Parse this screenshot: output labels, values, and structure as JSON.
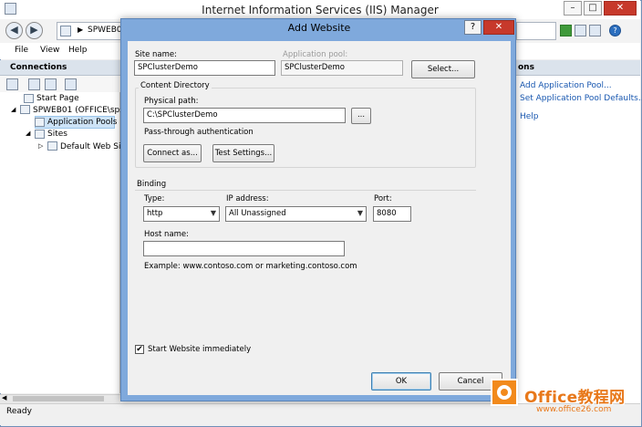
{
  "main_window": {
    "title": "Internet Information Services (IIS) Manager",
    "address": "SPWEB01",
    "menu": [
      "File",
      "View",
      "Help"
    ],
    "connections_title": "Connections",
    "tree": [
      {
        "label": "Start Page"
      },
      {
        "label": "SPWEB01 (OFFICE\\spset"
      },
      {
        "label": "Application Pools"
      },
      {
        "label": "Sites"
      },
      {
        "label": "Default Web Site"
      }
    ],
    "actions_title": "ons",
    "actions": [
      "Add Application Pool...",
      "Set Application Pool Defaults...",
      "Help"
    ],
    "status": "Ready"
  },
  "dialog": {
    "title": "Add Website",
    "site_name_label": "Site name:",
    "site_name_value": "SPClusterDemo",
    "app_pool_label": "Application pool:",
    "app_pool_value": "SPClusterDemo",
    "select_label": "Select...",
    "content_dir_label": "Content Directory",
    "physical_path_label": "Physical path:",
    "physical_path_value": "C:\\SPClusterDemo",
    "browse_label": "...",
    "auth_text": "Pass-through authentication",
    "connect_as_label": "Connect as...",
    "test_settings_label": "Test Settings...",
    "binding_label": "Binding",
    "type_label": "Type:",
    "type_value": "http",
    "ip_label": "IP address:",
    "ip_value": "All Unassigned",
    "port_label": "Port:",
    "port_value": "8080",
    "host_label": "Host name:",
    "host_value": "",
    "example_text": "Example: www.contoso.com or marketing.contoso.com",
    "start_label": "Start Website immediately",
    "start_checked": "✔",
    "ok_label": "OK",
    "cancel_label": "Cancel"
  },
  "watermark": {
    "brand": "Office教程网",
    "url": "www.office26.com"
  }
}
